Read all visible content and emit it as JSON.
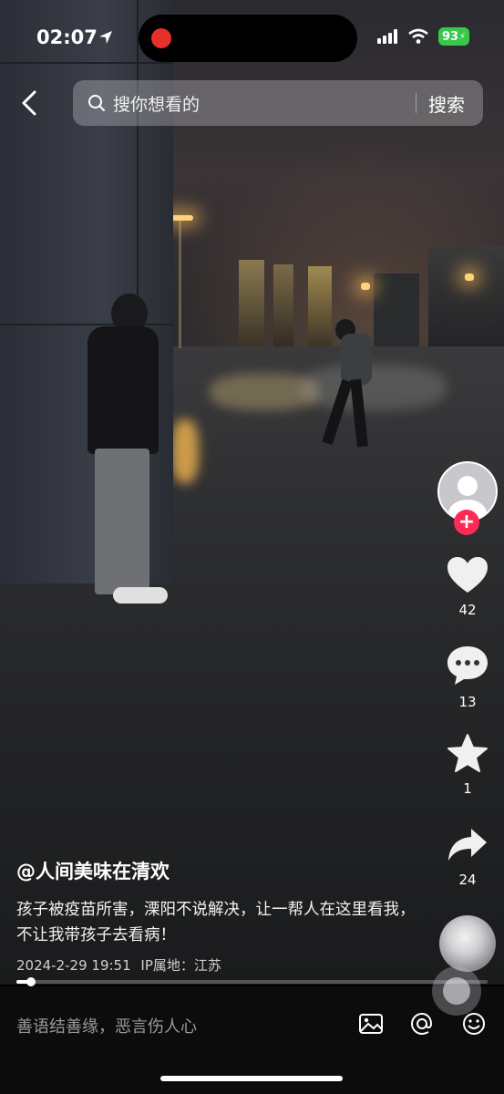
{
  "status_bar": {
    "time": "02:07",
    "battery": "93"
  },
  "search": {
    "placeholder": "搜你想看的",
    "button": "搜索"
  },
  "rail": {
    "likes": "42",
    "comments": "13",
    "favorites": "1",
    "shares": "24"
  },
  "video": {
    "author": "@人间美味在清欢",
    "description": "孩子被疫苗所害，溧阳不说解决，让一帮人在这里看我，不让我带孩子去看病！",
    "date": "2024-2-29 19:51",
    "ip_location": "IP属地：江苏",
    "progress": 0.03
  },
  "comment_bar": {
    "placeholder": "善语结善缘，恶言伤人心"
  },
  "colors": {
    "accent": "#fe2c55",
    "battery": "#38c84a",
    "recording": "#e8302a"
  },
  "icons": [
    "location-arrow-icon",
    "signal-icon",
    "wifi-icon",
    "battery-icon",
    "back-icon",
    "search-icon",
    "heart-icon",
    "comment-icon",
    "star-icon",
    "share-icon",
    "image-icon",
    "at-icon",
    "emoji-icon"
  ]
}
